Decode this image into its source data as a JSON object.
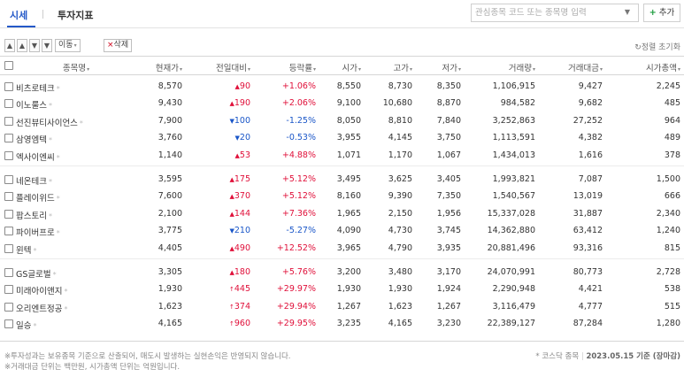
{
  "tabs": [
    {
      "label": "시세"
    },
    {
      "label": "투자지표"
    }
  ],
  "search": {
    "placeholder": "관심종목 코드 또는 종목명 입력",
    "add_label": "추가",
    "add_plus": "+"
  },
  "toolbar": {
    "buttons": [
      {
        "glyph": "▲",
        "icon": "move-top-icon"
      },
      {
        "glyph": "▲",
        "icon": "move-up-icon"
      },
      {
        "glyph": "▼",
        "icon": "move-down-icon"
      },
      {
        "glyph": "▼",
        "icon": "move-bottom-icon"
      }
    ],
    "move_label": "이동",
    "move_caret": "▾",
    "delete_x": "×",
    "delete_label": "삭제",
    "reset_icon": "↻",
    "reset_label": "정렬 초기화"
  },
  "columns": [
    "종목명",
    "현재가",
    "전일대비",
    "등락률",
    "시가",
    "고가",
    "저가",
    "거래량",
    "거래대금",
    "시가총액"
  ],
  "sort_glyph": "▾",
  "groups": [
    [
      {
        "name": "비츠로테크",
        "price": "8,570",
        "dir": "up",
        "arrow": "▲",
        "change": "90",
        "rate": "+1.06%",
        "open": "8,550",
        "high": "8,730",
        "low": "8,350",
        "volume": "1,106,915",
        "amount": "9,427",
        "cap": "2,245"
      },
      {
        "name": "이노룰스",
        "price": "9,430",
        "dir": "up",
        "arrow": "▲",
        "change": "190",
        "rate": "+2.06%",
        "open": "9,100",
        "high": "10,680",
        "low": "8,870",
        "volume": "984,582",
        "amount": "9,682",
        "cap": "485"
      },
      {
        "name": "선진뷰티사이언스",
        "price": "7,900",
        "dir": "down",
        "arrow": "▼",
        "change": "100",
        "rate": "-1.25%",
        "open": "8,050",
        "high": "8,810",
        "low": "7,840",
        "volume": "3,252,863",
        "amount": "27,252",
        "cap": "964"
      },
      {
        "name": "삼영엠텍",
        "price": "3,760",
        "dir": "down",
        "arrow": "▼",
        "change": "20",
        "rate": "-0.53%",
        "open": "3,955",
        "high": "4,145",
        "low": "3,750",
        "volume": "1,113,591",
        "amount": "4,382",
        "cap": "489"
      },
      {
        "name": "엑사이엔씨",
        "price": "1,140",
        "dir": "up",
        "arrow": "▲",
        "change": "53",
        "rate": "+4.88%",
        "open": "1,071",
        "high": "1,170",
        "low": "1,067",
        "volume": "1,434,013",
        "amount": "1,616",
        "cap": "378"
      }
    ],
    [
      {
        "name": "네온테크",
        "price": "3,595",
        "dir": "up",
        "arrow": "▲",
        "change": "175",
        "rate": "+5.12%",
        "open": "3,495",
        "high": "3,625",
        "low": "3,405",
        "volume": "1,993,821",
        "amount": "7,087",
        "cap": "1,500"
      },
      {
        "name": "플레이위드",
        "price": "7,600",
        "dir": "up",
        "arrow": "▲",
        "change": "370",
        "rate": "+5.12%",
        "open": "8,160",
        "high": "9,390",
        "low": "7,350",
        "volume": "1,540,567",
        "amount": "13,019",
        "cap": "666"
      },
      {
        "name": "팝스토리",
        "price": "2,100",
        "dir": "up",
        "arrow": "▲",
        "change": "144",
        "rate": "+7.36%",
        "open": "1,965",
        "high": "2,150",
        "low": "1,956",
        "volume": "15,337,028",
        "amount": "31,887",
        "cap": "2,340"
      },
      {
        "name": "파이버프로",
        "price": "3,775",
        "dir": "down",
        "arrow": "▼",
        "change": "210",
        "rate": "-5.27%",
        "open": "4,090",
        "high": "4,730",
        "low": "3,745",
        "volume": "14,362,880",
        "amount": "63,412",
        "cap": "1,240"
      },
      {
        "name": "윈텍",
        "price": "4,405",
        "dir": "up",
        "arrow": "▲",
        "change": "490",
        "rate": "+12.52%",
        "open": "3,965",
        "high": "4,790",
        "low": "3,935",
        "volume": "20,881,496",
        "amount": "93,316",
        "cap": "815"
      }
    ],
    [
      {
        "name": "GS글로벌",
        "price": "3,305",
        "dir": "up",
        "arrow": "▲",
        "change": "180",
        "rate": "+5.76%",
        "open": "3,200",
        "high": "3,480",
        "low": "3,170",
        "volume": "24,070,991",
        "amount": "80,773",
        "cap": "2,728"
      },
      {
        "name": "미래아이앤지",
        "price": "1,930",
        "dir": "up",
        "arrow": "↑",
        "change": "445",
        "rate": "+29.97%",
        "open": "1,930",
        "high": "1,930",
        "low": "1,924",
        "volume": "2,290,948",
        "amount": "4,421",
        "cap": "538"
      },
      {
        "name": "오리엔트정공",
        "price": "1,623",
        "dir": "up",
        "arrow": "↑",
        "change": "374",
        "rate": "+29.94%",
        "open": "1,267",
        "high": "1,623",
        "low": "1,267",
        "volume": "3,116,479",
        "amount": "4,777",
        "cap": "515"
      },
      {
        "name": "일승",
        "price": "4,165",
        "dir": "up",
        "arrow": "↑",
        "change": "960",
        "rate": "+29.95%",
        "open": "3,235",
        "high": "4,165",
        "low": "3,230",
        "volume": "22,389,127",
        "amount": "87,284",
        "cap": "1,280"
      }
    ]
  ],
  "row_marker": "*",
  "footer": {
    "note1": "※투자성과는 보유종목 기준으로 산출되어, 매도시 발생하는 실현손익은 반영되지 않습니다.",
    "note2": "※거래대금 단위는 백만원, 시가총액 단위는 억원입니다.",
    "right_note": "* 코스닥 종목",
    "right_date": "2023.05.15 기준 (장마감)"
  },
  "colors": {
    "accent": "#2459c8",
    "up": "#e0103a",
    "down": "#1a56c8",
    "add_plus": "#1a9b3c"
  }
}
